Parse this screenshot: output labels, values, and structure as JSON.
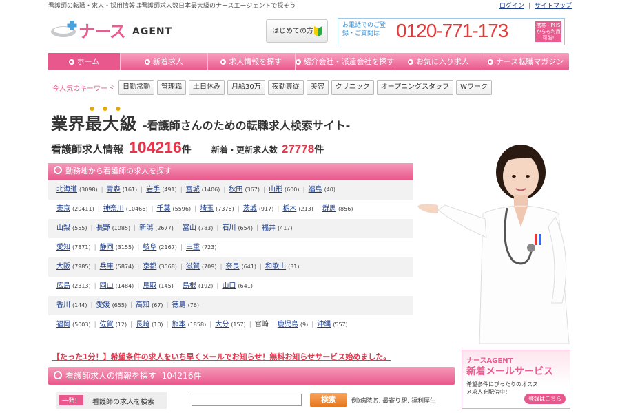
{
  "topbar": {
    "tagline": "看護師の転職・求人・採用情報は看護師求人数日本最大級のナースエージェントで探そう",
    "login": "ログイン",
    "sitemap": "サイトマップ"
  },
  "header": {
    "logo_jp": "ナース",
    "logo_en": "AGENT",
    "first_visit": "はじめての方",
    "phone_label": "お電話でのご登録・ご質問は",
    "phone_number": "0120-771-173",
    "phs_note": "携帯・PHSからも利用可能!"
  },
  "nav": [
    {
      "label": "ホーム"
    },
    {
      "label": "新着求人"
    },
    {
      "label": "求人情報を探す"
    },
    {
      "label": "紹介会社・派遣会社を探す"
    },
    {
      "label": "お気に入り求人"
    },
    {
      "label": "ナース転職マガジン"
    }
  ],
  "keywords": {
    "label": "今人気のキーワード",
    "tags": [
      "日勤常勤",
      "管理職",
      "土日休み",
      "月給30万",
      "夜勤専従",
      "美容",
      "クリニック",
      "オープニングスタッフ",
      "Wワーク"
    ]
  },
  "headline": {
    "big": "業界最大級",
    "sub": "-看護師さんのための転職求人検索サイト-"
  },
  "counts": {
    "label": "看護師求人情報",
    "total": "104216",
    "unit": "件",
    "new_label": "新着・更新求人数",
    "new_total": "27778",
    "new_unit": "件"
  },
  "regions": {
    "title": "勤務地から看護師の求人を探す",
    "rows": [
      [
        {
          "name": "北海道",
          "count": "(3098)"
        },
        {
          "name": "青森",
          "count": "(161)"
        },
        {
          "name": "岩手",
          "count": "(491)"
        },
        {
          "name": "宮城",
          "count": "(1406)"
        },
        {
          "name": "秋田",
          "count": "(367)"
        },
        {
          "name": "山形",
          "count": "(600)"
        },
        {
          "name": "福島",
          "count": "(40)"
        }
      ],
      [
        {
          "name": "東京",
          "count": "(20411)"
        },
        {
          "name": "神奈川",
          "count": "(10466)"
        },
        {
          "name": "千葉",
          "count": "(5596)"
        },
        {
          "name": "埼玉",
          "count": "(7376)"
        },
        {
          "name": "茨城",
          "count": "(917)"
        },
        {
          "name": "栃木",
          "count": "(213)"
        },
        {
          "name": "群馬",
          "count": "(856)"
        }
      ],
      [
        {
          "name": "山梨",
          "count": "(555)"
        },
        {
          "name": "長野",
          "count": "(1085)"
        },
        {
          "name": "新潟",
          "count": "(2677)"
        },
        {
          "name": "富山",
          "count": "(783)"
        },
        {
          "name": "石川",
          "count": "(654)"
        },
        {
          "name": "福井",
          "count": "(417)"
        }
      ],
      [
        {
          "name": "愛知",
          "count": "(7871)"
        },
        {
          "name": "静岡",
          "count": "(3155)"
        },
        {
          "name": "岐阜",
          "count": "(2167)"
        },
        {
          "name": "三重",
          "count": "(723)"
        }
      ],
      [
        {
          "name": "大阪",
          "count": "(7985)"
        },
        {
          "name": "兵庫",
          "count": "(5874)"
        },
        {
          "name": "京都",
          "count": "(3568)"
        },
        {
          "name": "滋賀",
          "count": "(709)"
        },
        {
          "name": "奈良",
          "count": "(641)"
        },
        {
          "name": "和歌山",
          "count": "(31)"
        }
      ],
      [
        {
          "name": "広島",
          "count": "(2313)"
        },
        {
          "name": "岡山",
          "count": "(1484)"
        },
        {
          "name": "鳥取",
          "count": "(145)"
        },
        {
          "name": "島根",
          "count": "(192)"
        },
        {
          "name": "山口",
          "count": "(641)"
        }
      ],
      [
        {
          "name": "香川",
          "count": "(144)"
        },
        {
          "name": "愛媛",
          "count": "(655)"
        },
        {
          "name": "高知",
          "count": "(67)"
        },
        {
          "name": "徳島",
          "count": "(76)"
        }
      ],
      [
        {
          "name": "福岡",
          "count": "(5003)"
        },
        {
          "name": "佐賀",
          "count": "(12)"
        },
        {
          "name": "長崎",
          "count": "(10)"
        },
        {
          "name": "熊本",
          "count": "(1858)"
        },
        {
          "name": "大分",
          "count": "(157)"
        },
        {
          "name": "宮崎",
          "count": "",
          "plain": true
        },
        {
          "name": "鹿児島",
          "count": "(9)"
        },
        {
          "name": "沖縄",
          "count": "(557)"
        }
      ]
    ]
  },
  "promo": "【たった1分！】希望条件の求人をいち早くメールでお知らせ！無料お知らせサービス始めました。",
  "search": {
    "title": "看護師求人の情報を探す",
    "total": "104216件",
    "badge": "一発！",
    "label": "看護師の求人を検索",
    "button": "検索",
    "example": "例)病院名, 最寄り駅, 福利厚生",
    "value": ""
  },
  "mail_banner": {
    "logo": "ナースAGENT",
    "title": "新着メールサービス",
    "desc": "希望条件にぴったりのオススメ求人を配信中！",
    "button": "登録はこちら"
  },
  "colors": {
    "accent": "#e9588c",
    "price_red": "#e8334a",
    "link": "#1a3c8c"
  }
}
